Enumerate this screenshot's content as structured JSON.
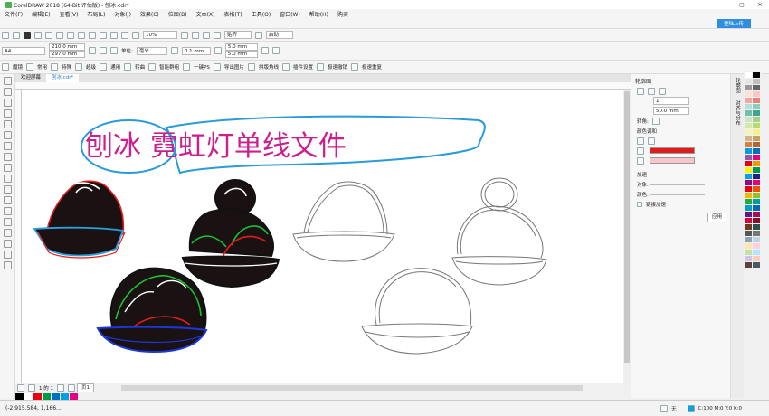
{
  "window": {
    "title": "CorelDRAW 2018 (64-Bit 评估版) - 刨冰.cdr*",
    "login": "登陆上传"
  },
  "menu": [
    "文件(F)",
    "编辑(E)",
    "查看(V)",
    "布局(L)",
    "对象(J)",
    "效果(C)",
    "位图(B)",
    "文本(X)",
    "表格(T)",
    "工具(O)",
    "窗口(W)",
    "帮助(H)",
    "购买"
  ],
  "standard": {
    "zoom": "10%",
    "snap": "贴齐",
    "launch": "启动"
  },
  "property": {
    "page": "A4",
    "width": "210.0 mm",
    "height": "297.0 mm",
    "unit_label": "单位:",
    "unit": "毫米",
    "nudge": "0.1 mm",
    "dup_x": "5.0 mm",
    "dup_y": "5.0 mm"
  },
  "plugin": [
    "魔镜",
    "常用",
    "特殊",
    "超级",
    "通用",
    "转曲",
    "智能群组",
    "一键PS",
    "导出图片",
    "拼版角线",
    "插件设置",
    "极速撤销",
    "极速重复"
  ],
  "tabs": [
    "欢迎屏幕",
    "刨冰.cdr*"
  ],
  "artwork": {
    "title": "刨冰 霓虹灯单线文件"
  },
  "page_nav": {
    "label": "1 的 1",
    "page": "页1"
  },
  "panel": {
    "title": "轮廓图",
    "steps": "1",
    "offset": "50.0 mm",
    "corner": "转角:",
    "color_section": "颜色调和",
    "outline_color": "#e01b1b",
    "fill_color": "#f6c6cc",
    "accel": "加速",
    "object": "对象:",
    "color": "颜色:",
    "link": "链接加速",
    "apply": "应用"
  },
  "side_tabs": [
    "轮廓图",
    "对齐与分布"
  ],
  "status": {
    "coords": "(-2,915.584, 1,166....",
    "fill": "无",
    "cmyk": "C:100 M:0 Y:0 K:0"
  },
  "swatches": [
    "#ffffff",
    "#000000",
    "#e6e6e6",
    "#bfbfbf",
    "#999999",
    "#666666",
    "#fde0dc",
    "#f8c9c4",
    "#f2a7a0",
    "#ec8079",
    "#b6dfd4",
    "#8bcdbe",
    "#6fc1ae",
    "#3ba88e",
    "#cfe3c2",
    "#a7d08d",
    "#d4e9a8",
    "#b7db6d",
    "#f2f5bd",
    "#f7f08e",
    "#d2b48c",
    "#c8a063",
    "#d97c3f",
    "#b8632c",
    "#009ee0",
    "#0070c0",
    "#8e5aa8",
    "#e6007e",
    "#e2001a",
    "#f39800",
    "#fff100",
    "#009944",
    "#00a0e9",
    "#1d2088",
    "#920783",
    "#e4007f",
    "#e60012",
    "#ea5504",
    "#f8b500",
    "#8fc31f",
    "#22ac38",
    "#009e96",
    "#00a0c1",
    "#0068b7",
    "#601986",
    "#a40b5d",
    "#d7003a",
    "#8a0b2a",
    "#6b3a1e",
    "#2f4f4f",
    "#555555",
    "#777777",
    "#8fa3b8",
    "#bcd4e6",
    "#fde7b0",
    "#ffd1dc",
    "#c5e1a5",
    "#b3e5fc",
    "#d1c4e9",
    "#ffccbc",
    "#5d4037",
    "#455a64"
  ],
  "doc_palette": [
    "#000000",
    "#ffffff",
    "#e60012",
    "#009944",
    "#0070c0",
    "#00a0e9",
    "#e6007e"
  ]
}
